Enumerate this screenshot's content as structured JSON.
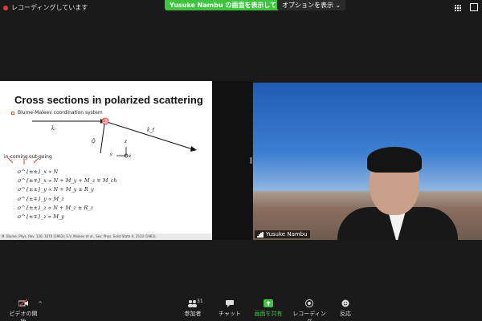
{
  "topbar": {
    "recording_label": "レコーディングしています",
    "share_banner": "Yusuke Nambu の画面を表示しています",
    "options_label": "オプションを表示 ⌄"
  },
  "slide": {
    "title": "Cross sections in polarized scattering",
    "bullet": "Blume-Maleev coordination system",
    "incoming": "in-coming",
    "outgoing": "out-going",
    "equations": [
      "σ^{±±}_x ∝ N",
      "σ^{±∓}_x ∝ N + M_y + M_z ∓ M_ch",
      "σ^{±±}_y ∝ N + M_y ± R_y",
      "σ^{±∓}_y ∝ M_z",
      "σ^{±±}_z ∝ N + M_z ± R_z",
      "σ^{±∓}_z ∝ M_y"
    ],
    "footer": "M. Blume, Phys. Rev. 130, 1670 (1963); S.V. Maleev et al., Sov. Phys. Solid State 4, 2533 (1963).",
    "labels": {
      "ki": "k̄ᵢ",
      "kf": "k̄_f",
      "q": "Q̄",
      "s": "S",
      "x": "x̂",
      "y": "ŷ",
      "z": "ẑ"
    }
  },
  "video": {
    "participant_name": "Yusuke Nambu"
  },
  "toolbar": {
    "video": "ビデオの開始",
    "participants": "参加者",
    "participants_count": "31",
    "chat": "チャット",
    "share": "画面を共有",
    "record": "レコーディング",
    "reactions": "反応"
  },
  "colors": {
    "share_green": "#3ec43e",
    "record_red": "#e03b3b",
    "bullet_orange": "#e06a2c"
  }
}
